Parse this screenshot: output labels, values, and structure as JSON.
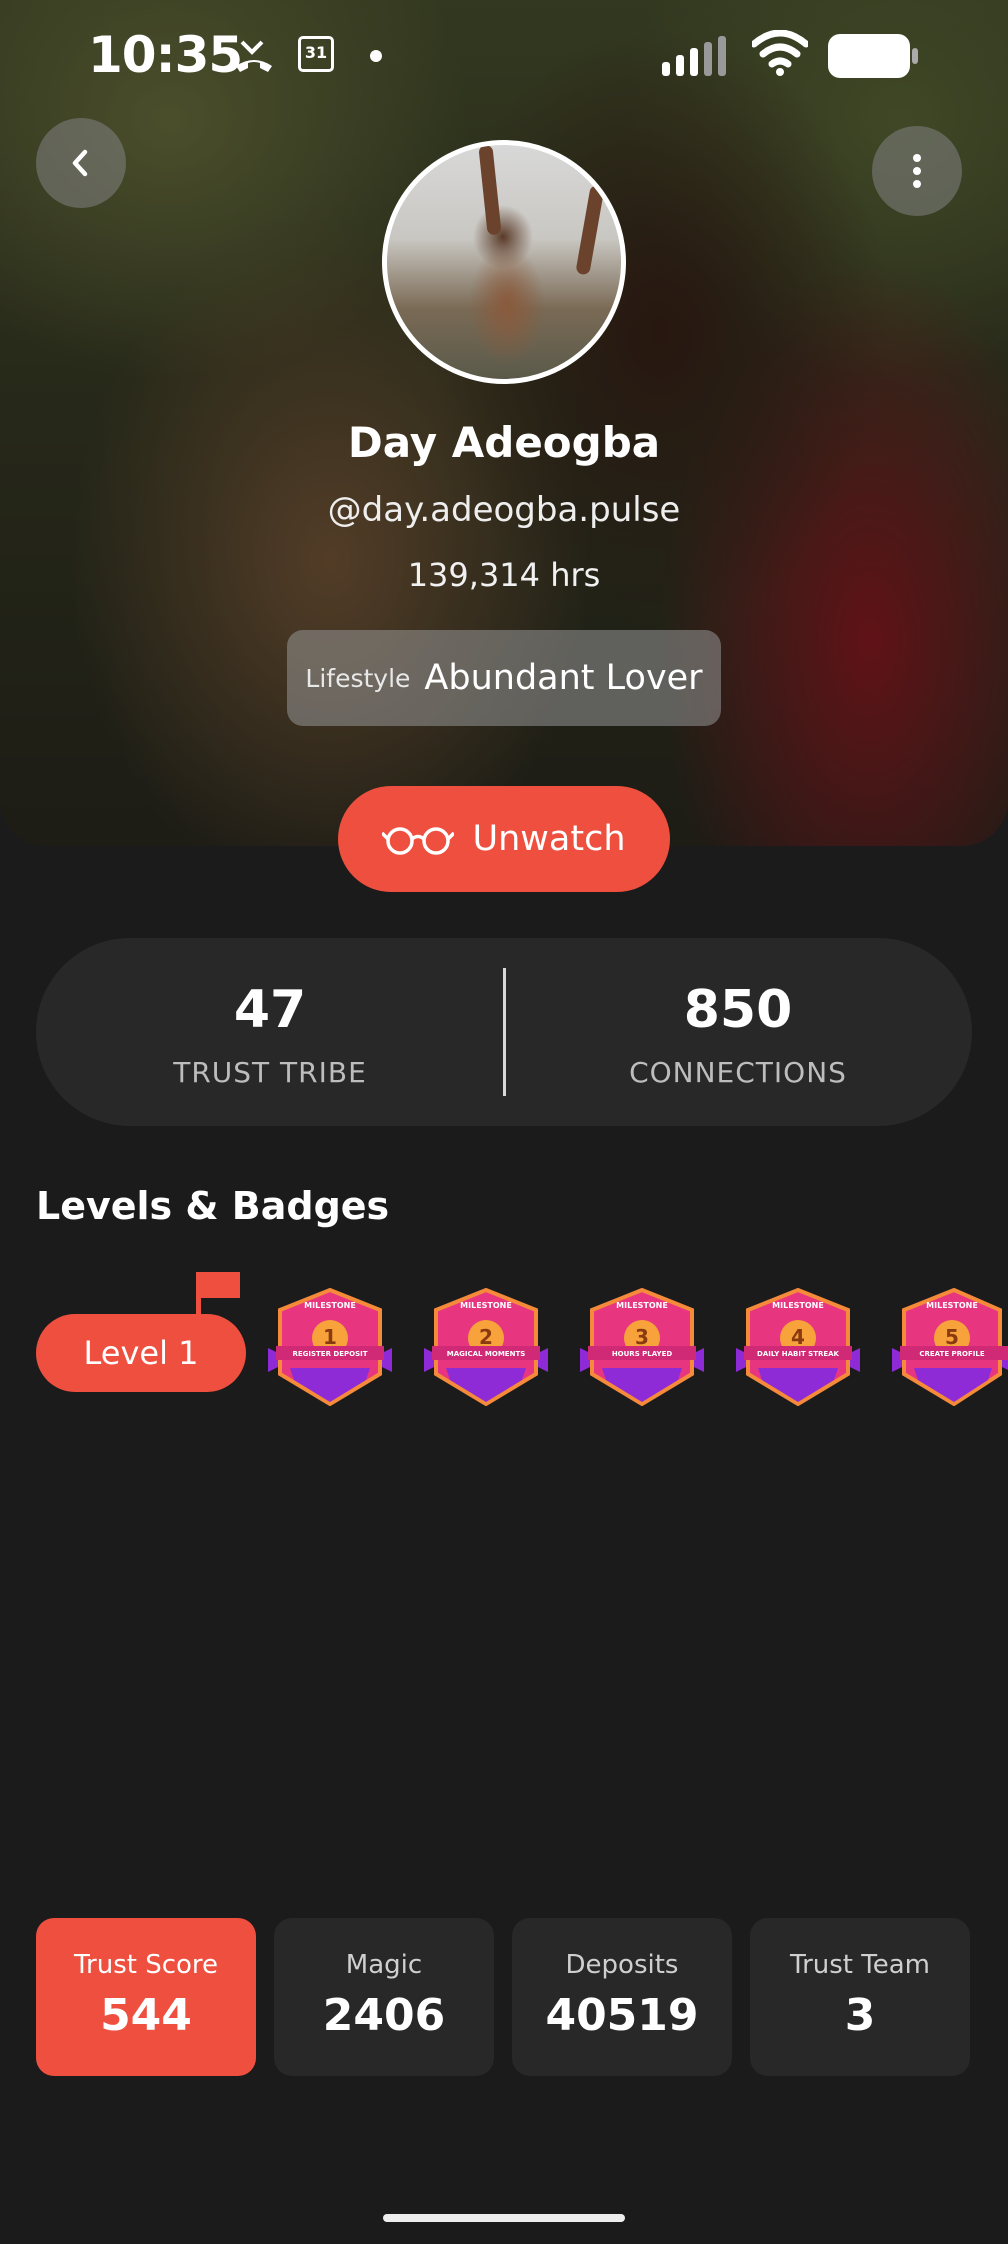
{
  "status_bar": {
    "time": "10:35",
    "calendar_day": "31"
  },
  "profile": {
    "name": "Day Adeogba",
    "handle": "@day.adeogba.pulse",
    "hours": "139,314 hrs",
    "lifestyle_label": "Lifestyle",
    "lifestyle_value": "Abundant Lover"
  },
  "actions": {
    "unwatch_label": "Unwatch"
  },
  "stats": [
    {
      "value": "47",
      "label": "TRUST TRIBE"
    },
    {
      "value": "850",
      "label": "CONNECTIONS"
    }
  ],
  "levels": {
    "title": "Levels & Badges",
    "level_label": "Level 1",
    "badges": [
      {
        "number": "1",
        "top": "MILESTONE",
        "name": "REGISTER DEPOSIT"
      },
      {
        "number": "2",
        "top": "MILESTONE",
        "name": "MAGICAL MOMENTS"
      },
      {
        "number": "3",
        "top": "MILESTONE",
        "name": "HOURS PLAYED"
      },
      {
        "number": "4",
        "top": "MILESTONE",
        "name": "DAILY HABIT STREAK"
      },
      {
        "number": "5",
        "top": "MILESTONE",
        "name": "CREATE PROFILE"
      }
    ]
  },
  "metrics": [
    {
      "title": "Trust Score",
      "value": "544",
      "active": true
    },
    {
      "title": "Magic",
      "value": "2406",
      "active": false
    },
    {
      "title": "Deposits",
      "value": "40519",
      "active": false
    },
    {
      "title": "Trust Team",
      "value": "3",
      "active": false
    }
  ],
  "colors": {
    "accent": "#ee4f3f",
    "background": "#1b1b1b",
    "card": "#282828"
  },
  "icons": [
    "back-icon",
    "more-vertical-icon",
    "glasses-icon",
    "flag-icon"
  ]
}
